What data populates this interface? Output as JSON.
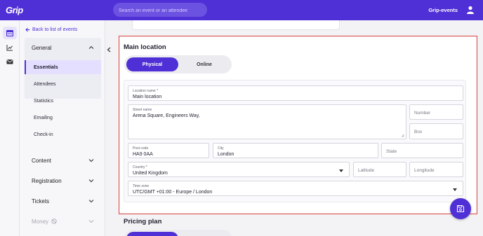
{
  "header": {
    "logo": "Grip",
    "search_placeholder": "Search an event or an attendee",
    "org_name": "Grip-events"
  },
  "rail": {
    "items": [
      {
        "icon": "calendar-icon",
        "active": true
      },
      {
        "icon": "chart-icon",
        "active": false
      },
      {
        "icon": "mail-icon",
        "active": false
      }
    ]
  },
  "sidebar": {
    "back_label": "Back to list of events",
    "general_label": "General",
    "sub_items": [
      "Essentials",
      "Attendees",
      "Statistics",
      "Emailing",
      "Check-in"
    ],
    "groups": [
      "Content",
      "Registration",
      "Tickets",
      "Money"
    ]
  },
  "main": {
    "section_title": "Main location",
    "tab_physical": "Physical",
    "tab_online": "Online",
    "fields": {
      "location_name": {
        "label": "Location name *",
        "value": "Main location"
      },
      "street_name": {
        "label": "Street name",
        "value": "Arena Square, Engineers Way,"
      },
      "number": {
        "placeholder": "Number"
      },
      "box": {
        "placeholder": "Box"
      },
      "post_code": {
        "label": "Post code",
        "value": "HA9 0AA"
      },
      "city": {
        "label": "City",
        "value": "London"
      },
      "state": {
        "placeholder": "State"
      },
      "country": {
        "label": "Country *",
        "value": "United Kingdom"
      },
      "latitude": {
        "placeholder": "Latitude"
      },
      "longitude": {
        "placeholder": "Longitude"
      },
      "time_zone": {
        "label": "Time zone",
        "value": "UTC/GMT +01:00 - Europe / London"
      }
    },
    "pricing_title": "Pricing plan"
  },
  "colors": {
    "brand": "#4f2fd6",
    "highlight": "#e0463f"
  }
}
